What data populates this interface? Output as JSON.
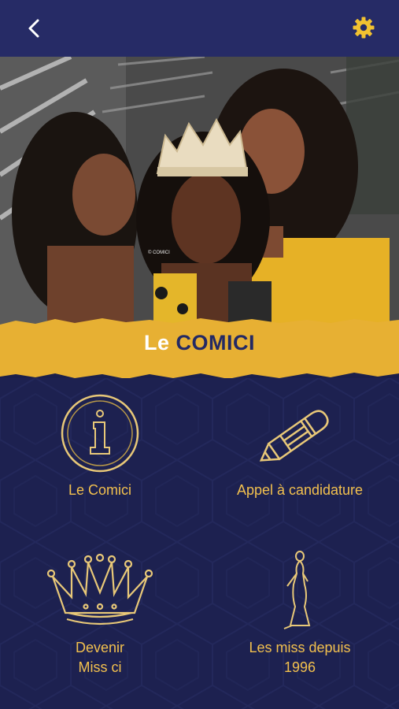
{
  "header": {
    "back_icon": "chevron-left-icon",
    "settings_icon": "gear-icon",
    "icon_color": "#f2c230",
    "bar_color": "#262b66"
  },
  "hero": {
    "image": "photo-three-miss-winners-with-crown",
    "watermark": "© COMICI"
  },
  "banner": {
    "title_part1": "Le ",
    "title_part2": "COMICI",
    "color": "#e7b033"
  },
  "menu": {
    "items": [
      {
        "label": "Le Comici",
        "icon": "info-medallion-icon"
      },
      {
        "label": "Appel à candidature",
        "icon": "pencil-icon"
      },
      {
        "label": "Devenir Miss ci",
        "icon": "crown-icon"
      },
      {
        "label": "Les miss depuis 1996",
        "icon": "woman-gown-silhouette-icon"
      }
    ],
    "accent_color": "#f2c04e",
    "background": "#1d2150"
  }
}
